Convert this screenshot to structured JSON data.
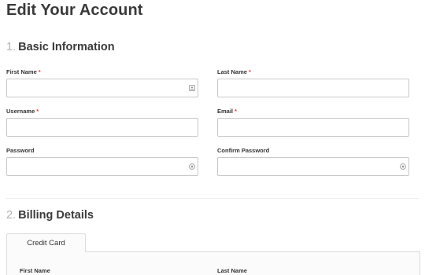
{
  "page_title": "Edit Your Account",
  "sections": {
    "basic": {
      "number": "1.",
      "title": "Basic Information"
    },
    "billing": {
      "number": "2.",
      "title": "Billing Details"
    }
  },
  "required_marker": "*",
  "fields": {
    "first_name": {
      "label": "First Name",
      "required": true,
      "value": "",
      "icon": "contact-card-icon"
    },
    "last_name": {
      "label": "Last Name",
      "required": true,
      "value": ""
    },
    "username": {
      "label": "Username",
      "required": true,
      "value": ""
    },
    "email": {
      "label": "Email",
      "required": true,
      "value": ""
    },
    "password": {
      "label": "Password",
      "required": false,
      "value": "",
      "icon": "password-reveal-icon"
    },
    "confirm_password": {
      "label": "Confirm Password",
      "required": false,
      "value": "",
      "icon": "password-reveal-icon"
    }
  },
  "billing": {
    "tabs": [
      {
        "label": "Credit Card",
        "active": true
      }
    ],
    "card_fields": {
      "first_name": {
        "label": "First Name"
      },
      "last_name": {
        "label": "Last Name"
      }
    }
  },
  "colors": {
    "required": "#e0413a",
    "input_border": "#c8c8c8",
    "muted_number": "#b3b3b3"
  }
}
